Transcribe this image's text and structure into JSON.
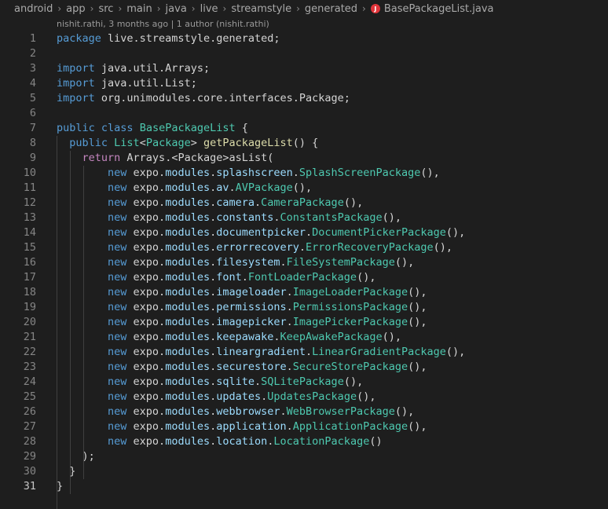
{
  "breadcrumb": {
    "items": [
      "android",
      "app",
      "src",
      "main",
      "java",
      "live",
      "streamstyle",
      "generated"
    ],
    "file_name": "BasePackageList.java",
    "file_icon_letter": "J",
    "file_icon_color": "#e0343a"
  },
  "codelens": {
    "text": "nishit.rathi, 3 months ago | 1 author (nishit.rathi)"
  },
  "code": {
    "lines": [
      {
        "n": "1",
        "tokens": [
          {
            "t": "package ",
            "c": "kw"
          },
          {
            "t": "live.streamstyle.generated;",
            "c": "pl"
          }
        ]
      },
      {
        "n": "2",
        "tokens": []
      },
      {
        "n": "3",
        "tokens": [
          {
            "t": "import ",
            "c": "kw"
          },
          {
            "t": "java.util.Arrays;",
            "c": "pl"
          }
        ]
      },
      {
        "n": "4",
        "tokens": [
          {
            "t": "import ",
            "c": "kw"
          },
          {
            "t": "java.util.List;",
            "c": "pl"
          }
        ]
      },
      {
        "n": "5",
        "tokens": [
          {
            "t": "import ",
            "c": "kw"
          },
          {
            "t": "org.unimodules.core.interfaces.Package;",
            "c": "pl"
          }
        ]
      },
      {
        "n": "6",
        "tokens": []
      },
      {
        "n": "7",
        "tokens": [
          {
            "t": "public ",
            "c": "kw"
          },
          {
            "t": "class ",
            "c": "kw"
          },
          {
            "t": "BasePackageList",
            "c": "cls"
          },
          {
            "t": " {",
            "c": "pl"
          }
        ]
      },
      {
        "n": "8",
        "tokens": [
          {
            "t": "  ",
            "c": "pl"
          },
          {
            "t": "public ",
            "c": "kw"
          },
          {
            "t": "List",
            "c": "cls"
          },
          {
            "t": "<",
            "c": "pl"
          },
          {
            "t": "Package",
            "c": "cls"
          },
          {
            "t": "> ",
            "c": "pl"
          },
          {
            "t": "getPackageList",
            "c": "fn"
          },
          {
            "t": "() {",
            "c": "pl"
          }
        ]
      },
      {
        "n": "9",
        "tokens": [
          {
            "t": "    ",
            "c": "pl"
          },
          {
            "t": "return ",
            "c": "kw2"
          },
          {
            "t": "Arrays.<Package>asList(",
            "c": "pl"
          }
        ]
      },
      {
        "n": "10",
        "tokens": [
          {
            "t": "        ",
            "c": "pl"
          },
          {
            "t": "new ",
            "c": "kw"
          },
          {
            "t": "expo.",
            "c": "pl"
          },
          {
            "t": "modules",
            "c": "pkg"
          },
          {
            "t": ".",
            "c": "pl"
          },
          {
            "t": "splashscreen",
            "c": "pkg"
          },
          {
            "t": ".",
            "c": "pl"
          },
          {
            "t": "SplashScreenPackage",
            "c": "cls"
          },
          {
            "t": "(),",
            "c": "pl"
          }
        ]
      },
      {
        "n": "11",
        "tokens": [
          {
            "t": "        ",
            "c": "pl"
          },
          {
            "t": "new ",
            "c": "kw"
          },
          {
            "t": "expo.",
            "c": "pl"
          },
          {
            "t": "modules",
            "c": "pkg"
          },
          {
            "t": ".",
            "c": "pl"
          },
          {
            "t": "av",
            "c": "pkg"
          },
          {
            "t": ".",
            "c": "pl"
          },
          {
            "t": "AVPackage",
            "c": "cls"
          },
          {
            "t": "(),",
            "c": "pl"
          }
        ]
      },
      {
        "n": "12",
        "tokens": [
          {
            "t": "        ",
            "c": "pl"
          },
          {
            "t": "new ",
            "c": "kw"
          },
          {
            "t": "expo.",
            "c": "pl"
          },
          {
            "t": "modules",
            "c": "pkg"
          },
          {
            "t": ".",
            "c": "pl"
          },
          {
            "t": "camera",
            "c": "pkg"
          },
          {
            "t": ".",
            "c": "pl"
          },
          {
            "t": "CameraPackage",
            "c": "cls"
          },
          {
            "t": "(),",
            "c": "pl"
          }
        ]
      },
      {
        "n": "13",
        "tokens": [
          {
            "t": "        ",
            "c": "pl"
          },
          {
            "t": "new ",
            "c": "kw"
          },
          {
            "t": "expo.",
            "c": "pl"
          },
          {
            "t": "modules",
            "c": "pkg"
          },
          {
            "t": ".",
            "c": "pl"
          },
          {
            "t": "constants",
            "c": "pkg"
          },
          {
            "t": ".",
            "c": "pl"
          },
          {
            "t": "ConstantsPackage",
            "c": "cls"
          },
          {
            "t": "(),",
            "c": "pl"
          }
        ]
      },
      {
        "n": "14",
        "tokens": [
          {
            "t": "        ",
            "c": "pl"
          },
          {
            "t": "new ",
            "c": "kw"
          },
          {
            "t": "expo.",
            "c": "pl"
          },
          {
            "t": "modules",
            "c": "pkg"
          },
          {
            "t": ".",
            "c": "pl"
          },
          {
            "t": "documentpicker",
            "c": "pkg"
          },
          {
            "t": ".",
            "c": "pl"
          },
          {
            "t": "DocumentPickerPackage",
            "c": "cls"
          },
          {
            "t": "(),",
            "c": "pl"
          }
        ]
      },
      {
        "n": "15",
        "tokens": [
          {
            "t": "        ",
            "c": "pl"
          },
          {
            "t": "new ",
            "c": "kw"
          },
          {
            "t": "expo.",
            "c": "pl"
          },
          {
            "t": "modules",
            "c": "pkg"
          },
          {
            "t": ".",
            "c": "pl"
          },
          {
            "t": "errorrecovery",
            "c": "pkg"
          },
          {
            "t": ".",
            "c": "pl"
          },
          {
            "t": "ErrorRecoveryPackage",
            "c": "cls"
          },
          {
            "t": "(),",
            "c": "pl"
          }
        ]
      },
      {
        "n": "16",
        "tokens": [
          {
            "t": "        ",
            "c": "pl"
          },
          {
            "t": "new ",
            "c": "kw"
          },
          {
            "t": "expo.",
            "c": "pl"
          },
          {
            "t": "modules",
            "c": "pkg"
          },
          {
            "t": ".",
            "c": "pl"
          },
          {
            "t": "filesystem",
            "c": "pkg"
          },
          {
            "t": ".",
            "c": "pl"
          },
          {
            "t": "FileSystemPackage",
            "c": "cls"
          },
          {
            "t": "(),",
            "c": "pl"
          }
        ]
      },
      {
        "n": "17",
        "tokens": [
          {
            "t": "        ",
            "c": "pl"
          },
          {
            "t": "new ",
            "c": "kw"
          },
          {
            "t": "expo.",
            "c": "pl"
          },
          {
            "t": "modules",
            "c": "pkg"
          },
          {
            "t": ".",
            "c": "pl"
          },
          {
            "t": "font",
            "c": "pkg"
          },
          {
            "t": ".",
            "c": "pl"
          },
          {
            "t": "FontLoaderPackage",
            "c": "cls"
          },
          {
            "t": "(),",
            "c": "pl"
          }
        ]
      },
      {
        "n": "18",
        "tokens": [
          {
            "t": "        ",
            "c": "pl"
          },
          {
            "t": "new ",
            "c": "kw"
          },
          {
            "t": "expo.",
            "c": "pl"
          },
          {
            "t": "modules",
            "c": "pkg"
          },
          {
            "t": ".",
            "c": "pl"
          },
          {
            "t": "imageloader",
            "c": "pkg"
          },
          {
            "t": ".",
            "c": "pl"
          },
          {
            "t": "ImageLoaderPackage",
            "c": "cls"
          },
          {
            "t": "(),",
            "c": "pl"
          }
        ]
      },
      {
        "n": "19",
        "tokens": [
          {
            "t": "        ",
            "c": "pl"
          },
          {
            "t": "new ",
            "c": "kw"
          },
          {
            "t": "expo.",
            "c": "pl"
          },
          {
            "t": "modules",
            "c": "pkg"
          },
          {
            "t": ".",
            "c": "pl"
          },
          {
            "t": "permissions",
            "c": "pkg"
          },
          {
            "t": ".",
            "c": "pl"
          },
          {
            "t": "PermissionsPackage",
            "c": "cls"
          },
          {
            "t": "(),",
            "c": "pl"
          }
        ]
      },
      {
        "n": "20",
        "tokens": [
          {
            "t": "        ",
            "c": "pl"
          },
          {
            "t": "new ",
            "c": "kw"
          },
          {
            "t": "expo.",
            "c": "pl"
          },
          {
            "t": "modules",
            "c": "pkg"
          },
          {
            "t": ".",
            "c": "pl"
          },
          {
            "t": "imagepicker",
            "c": "pkg"
          },
          {
            "t": ".",
            "c": "pl"
          },
          {
            "t": "ImagePickerPackage",
            "c": "cls"
          },
          {
            "t": "(),",
            "c": "pl"
          }
        ]
      },
      {
        "n": "21",
        "tokens": [
          {
            "t": "        ",
            "c": "pl"
          },
          {
            "t": "new ",
            "c": "kw"
          },
          {
            "t": "expo.",
            "c": "pl"
          },
          {
            "t": "modules",
            "c": "pkg"
          },
          {
            "t": ".",
            "c": "pl"
          },
          {
            "t": "keepawake",
            "c": "pkg"
          },
          {
            "t": ".",
            "c": "pl"
          },
          {
            "t": "KeepAwakePackage",
            "c": "cls"
          },
          {
            "t": "(),",
            "c": "pl"
          }
        ]
      },
      {
        "n": "22",
        "tokens": [
          {
            "t": "        ",
            "c": "pl"
          },
          {
            "t": "new ",
            "c": "kw"
          },
          {
            "t": "expo.",
            "c": "pl"
          },
          {
            "t": "modules",
            "c": "pkg"
          },
          {
            "t": ".",
            "c": "pl"
          },
          {
            "t": "lineargradient",
            "c": "pkg"
          },
          {
            "t": ".",
            "c": "pl"
          },
          {
            "t": "LinearGradientPackage",
            "c": "cls"
          },
          {
            "t": "(),",
            "c": "pl"
          }
        ]
      },
      {
        "n": "23",
        "tokens": [
          {
            "t": "        ",
            "c": "pl"
          },
          {
            "t": "new ",
            "c": "kw"
          },
          {
            "t": "expo.",
            "c": "pl"
          },
          {
            "t": "modules",
            "c": "pkg"
          },
          {
            "t": ".",
            "c": "pl"
          },
          {
            "t": "securestore",
            "c": "pkg"
          },
          {
            "t": ".",
            "c": "pl"
          },
          {
            "t": "SecureStorePackage",
            "c": "cls"
          },
          {
            "t": "(),",
            "c": "pl"
          }
        ]
      },
      {
        "n": "24",
        "tokens": [
          {
            "t": "        ",
            "c": "pl"
          },
          {
            "t": "new ",
            "c": "kw"
          },
          {
            "t": "expo.",
            "c": "pl"
          },
          {
            "t": "modules",
            "c": "pkg"
          },
          {
            "t": ".",
            "c": "pl"
          },
          {
            "t": "sqlite",
            "c": "pkg"
          },
          {
            "t": ".",
            "c": "pl"
          },
          {
            "t": "SQLitePackage",
            "c": "cls"
          },
          {
            "t": "(),",
            "c": "pl"
          }
        ]
      },
      {
        "n": "25",
        "tokens": [
          {
            "t": "        ",
            "c": "pl"
          },
          {
            "t": "new ",
            "c": "kw"
          },
          {
            "t": "expo.",
            "c": "pl"
          },
          {
            "t": "modules",
            "c": "pkg"
          },
          {
            "t": ".",
            "c": "pl"
          },
          {
            "t": "updates",
            "c": "pkg"
          },
          {
            "t": ".",
            "c": "pl"
          },
          {
            "t": "UpdatesPackage",
            "c": "cls"
          },
          {
            "t": "(),",
            "c": "pl"
          }
        ]
      },
      {
        "n": "26",
        "tokens": [
          {
            "t": "        ",
            "c": "pl"
          },
          {
            "t": "new ",
            "c": "kw"
          },
          {
            "t": "expo.",
            "c": "pl"
          },
          {
            "t": "modules",
            "c": "pkg"
          },
          {
            "t": ".",
            "c": "pl"
          },
          {
            "t": "webbrowser",
            "c": "pkg"
          },
          {
            "t": ".",
            "c": "pl"
          },
          {
            "t": "WebBrowserPackage",
            "c": "cls"
          },
          {
            "t": "(),",
            "c": "pl"
          }
        ]
      },
      {
        "n": "27",
        "tokens": [
          {
            "t": "        ",
            "c": "pl"
          },
          {
            "t": "new ",
            "c": "kw"
          },
          {
            "t": "expo.",
            "c": "pl"
          },
          {
            "t": "modules",
            "c": "pkg"
          },
          {
            "t": ".",
            "c": "pl"
          },
          {
            "t": "application",
            "c": "pkg"
          },
          {
            "t": ".",
            "c": "pl"
          },
          {
            "t": "ApplicationPackage",
            "c": "cls"
          },
          {
            "t": "(),",
            "c": "pl"
          }
        ]
      },
      {
        "n": "28",
        "tokens": [
          {
            "t": "        ",
            "c": "pl"
          },
          {
            "t": "new ",
            "c": "kw"
          },
          {
            "t": "expo.",
            "c": "pl"
          },
          {
            "t": "modules",
            "c": "pkg"
          },
          {
            "t": ".",
            "c": "pl"
          },
          {
            "t": "location",
            "c": "pkg"
          },
          {
            "t": ".",
            "c": "pl"
          },
          {
            "t": "LocationPackage",
            "c": "cls"
          },
          {
            "t": "()",
            "c": "pl"
          }
        ]
      },
      {
        "n": "29",
        "tokens": [
          {
            "t": "    );",
            "c": "pl"
          }
        ]
      },
      {
        "n": "30",
        "tokens": [
          {
            "t": "  }",
            "c": "pl"
          }
        ]
      },
      {
        "n": "31",
        "tokens": [
          {
            "t": "}",
            "c": "pl"
          }
        ]
      }
    ]
  }
}
